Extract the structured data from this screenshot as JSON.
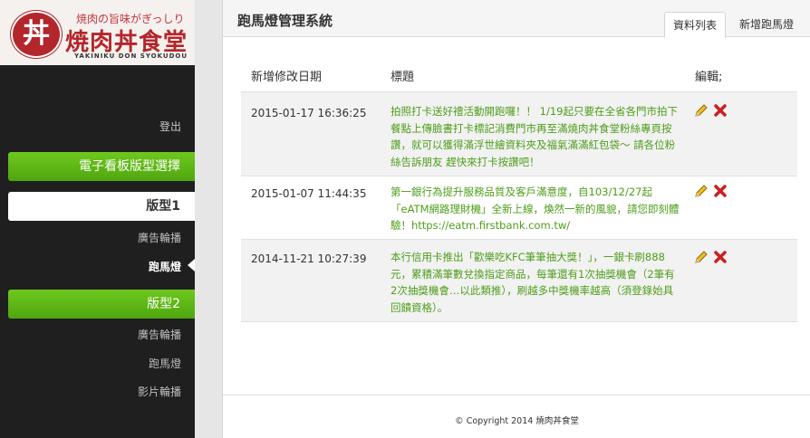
{
  "logo": {
    "tagline": "焼肉の旨味がぎっしり",
    "name": "焼肉丼食堂",
    "subtitle": "YAKINIKU DON SYOKUDOU",
    "mark": "丼"
  },
  "sidebar": {
    "logout": "登出",
    "group1": "電子看板版型選擇",
    "layout1": "版型1",
    "layout1_items": [
      "廣告輪播",
      "跑馬燈"
    ],
    "layout2": "版型2",
    "layout2_items": [
      "廣告輪播",
      "跑馬燈",
      "影片輪播"
    ]
  },
  "header": {
    "title": "跑馬燈管理系統",
    "tabs": [
      "資料列表",
      "新增跑馬燈"
    ]
  },
  "table": {
    "columns": [
      "新增修改日期",
      "標題",
      "編輯;"
    ],
    "rows": [
      {
        "date": "2015-01-17 16:36:25",
        "title": "拍照打卡送好禮活動開跑囉！！ 1/19起只要在全省各門市拍下餐點上傳臉書打卡標記消費門市再至滿燒肉丼食堂粉絲專頁按讚，就可以獲得滿浮世繪資料夾及福氣滿滿紅包袋～ 請各位粉絲告訴朋友 趕快來打卡按讚吧！"
      },
      {
        "date": "2015-01-07 11:44:35",
        "title": "第一銀行為提升服務品質及客戶滿意度，自103/12/27起「eATM網路理財機」全新上線，煥然一新的風貌，請您即刻體驗！https://eatm.firstbank.com.tw/"
      },
      {
        "date": "2014-11-21 10:27:39",
        "title": "本行信用卡推出「歡樂吃KFC筆筆抽大獎！」，一銀卡刷888元，累積滿筆數兌換指定商品，每筆還有1次抽獎機會（2筆有2次抽獎機會…以此類推），刷越多中獎機率越高（須登錄始具回饋資格）。"
      }
    ]
  },
  "footer": "© Copyright 2014 燒肉丼食堂",
  "colors": {
    "accent_green": "#5cb814",
    "title_green": "#4e9d1a",
    "delete_red": "#cc1f1f",
    "brand_red": "#b3262b"
  },
  "icons": {
    "edit": "pencil-icon",
    "delete": "delete-x-icon"
  }
}
